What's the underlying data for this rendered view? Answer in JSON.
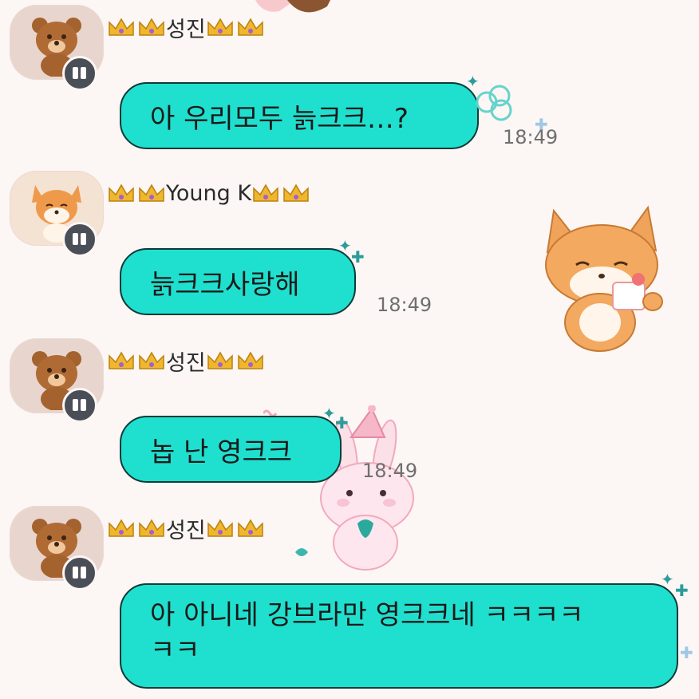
{
  "messages": [
    {
      "sender": "성진",
      "text": "아 우리모두 늙크크…?",
      "time": "18:49"
    },
    {
      "sender": "Young K",
      "text": "늙크크사랑해",
      "time": "18:49"
    },
    {
      "sender": "성진",
      "text": "놉 난 영크크",
      "time": "18:49"
    },
    {
      "sender": "성진",
      "text": "아 아니네 강브라만 영크크네 ㅋㅋㅋㅋ\nㅋㅋ",
      "time": ""
    }
  ],
  "icons": {
    "avatar_bear": "bear-avatar-icon",
    "avatar_fox": "fox-avatar-icon",
    "badge": "phone-badge-icon",
    "crown": "crown-icon",
    "sticker_fox": "fox-sticker-icon",
    "sticker_bunny": "bunny-sticker-icon"
  },
  "colors": {
    "background": "#fcf6f4",
    "bubble": "#1fe0cf",
    "bubble_border": "#0e3a38",
    "time_text": "#6f6f6f"
  }
}
